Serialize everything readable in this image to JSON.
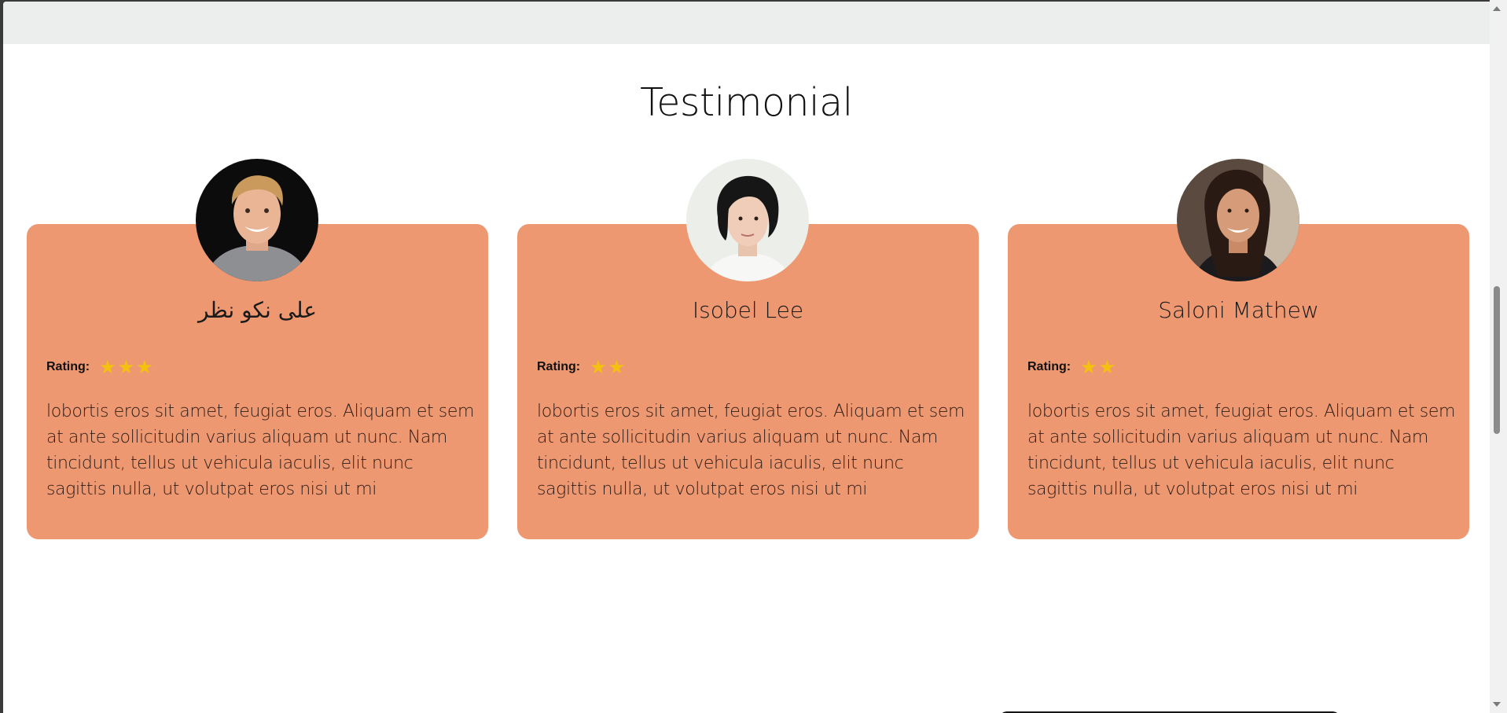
{
  "section": {
    "title": "Testimonial"
  },
  "testimonials": [
    {
      "name": "علی نکو نظر",
      "rating_label": "Rating:",
      "stars": 3,
      "quote": "lobortis eros sit amet, feugiat eros. Aliquam et sem at ante sollicitudin varius aliquam ut nunc. Nam tincidunt, tellus ut vehicula iaculis, elit nunc sagittis nulla, ut volutpat eros nisi ut mi"
    },
    {
      "name": "Isobel Lee",
      "rating_label": "Rating:",
      "stars": 2,
      "quote": "lobortis eros sit amet, feugiat eros. Aliquam et sem at ante sollicitudin varius aliquam ut nunc. Nam tincidunt, tellus ut vehicula iaculis, elit nunc sagittis nulla, ut volutpat eros nisi ut mi"
    },
    {
      "name": "Saloni Mathew",
      "rating_label": "Rating:",
      "stars": 2,
      "quote": "lobortis eros sit amet, feugiat eros. Aliquam et sem at ante sollicitudin varius aliquam ut nunc. Nam tincidunt, tellus ut vehicula iaculis, elit nunc sagittis nulla, ut volutpat eros nisi ut mi"
    }
  ],
  "colors": {
    "card_background": "#ee9872",
    "star": "#f4c20d",
    "top_strip": "#eceeed"
  },
  "icons": {
    "star": "star-icon",
    "scroll_up": "chevron-up-icon",
    "scroll_down": "chevron-down-icon"
  }
}
